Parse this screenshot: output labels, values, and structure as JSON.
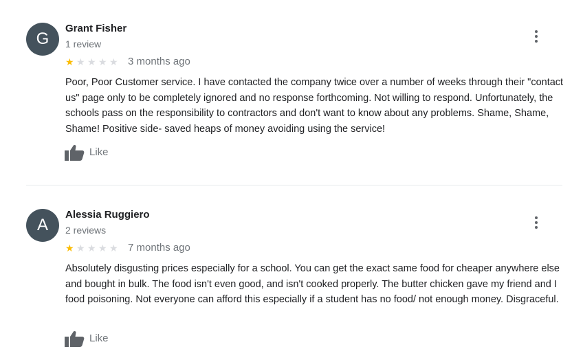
{
  "reviews": [
    {
      "avatar_letter": "G",
      "name": "Grant Fisher",
      "review_count": "1 review",
      "rating": 1,
      "max_rating": 5,
      "date": "3 months ago",
      "text": "Poor, Poor Customer service. I have contacted the company twice over a number of weeks through their \"contact us\" page only to be completely ignored and no response forthcoming. Not willing to respond. Unfortunately, the schools pass on the responsibility to contractors and  don't want to know about any problems. Shame, Shame, Shame! Positive side- saved heaps of money avoiding using the service!",
      "like_label": "Like"
    },
    {
      "avatar_letter": "A",
      "name": "Alessia Ruggiero",
      "review_count": "2 reviews",
      "rating": 1,
      "max_rating": 5,
      "date": "7 months ago",
      "text": "Absolutely disgusting prices especially for a school. You can get the exact same food for cheaper anywhere else and bought in bulk. The food isn't even good, and isn't cooked properly. The butter chicken gave my friend and I food poisoning. Not everyone can afford this especially if a student has no food/ not enough money. Disgraceful.",
      "like_label": "Like"
    }
  ],
  "colors": {
    "avatar_bg": "#44525c",
    "star_filled": "#fbbc04",
    "star_empty": "#dadce0",
    "secondary_text": "#70757a",
    "icon": "#5f6368"
  },
  "icons": {
    "more": "more-vert-icon",
    "like": "thumb-up-icon",
    "star": "star-icon"
  }
}
